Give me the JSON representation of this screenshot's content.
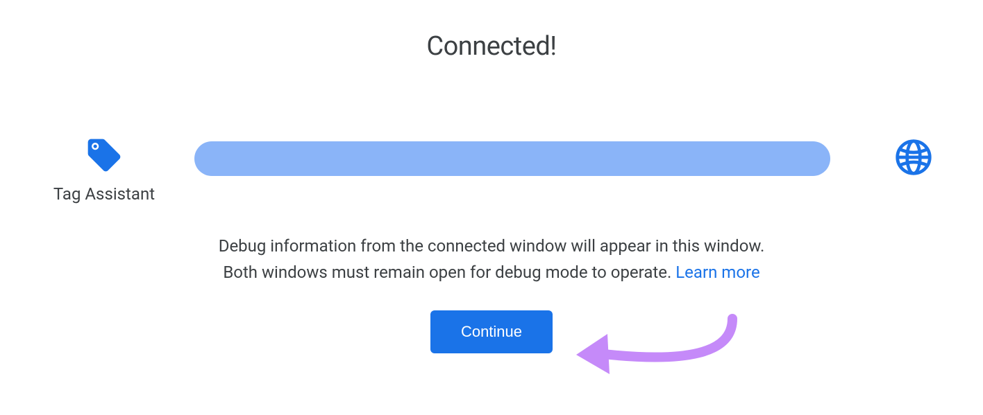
{
  "title": "Connected!",
  "tagAssistant": {
    "label": "Tag Assistant"
  },
  "description": {
    "line1": "Debug information from the connected window will appear in this window.",
    "line2a": "Both windows must remain open for debug mode to operate. ",
    "learnMore": "Learn more"
  },
  "button": {
    "continue": "Continue"
  },
  "colors": {
    "primary": "#1a73e8",
    "progressFill": "#8ab4f8",
    "text": "#3c4043",
    "annotation": "#c58af9"
  }
}
